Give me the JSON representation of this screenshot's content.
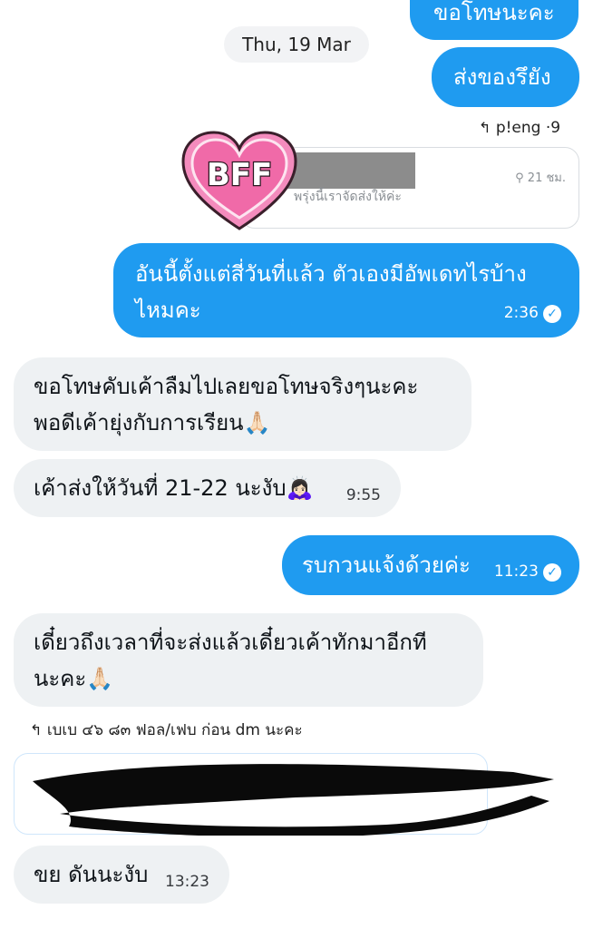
{
  "messages": {
    "m0": {
      "text": "ขอโทษนะคะ"
    },
    "date_separator": "Thu, 19 Mar",
    "m1": {
      "text": "ส่งของรึยัง"
    },
    "reply1": {
      "label": "p!eng ·9"
    },
    "card1": {
      "sticker_text": "BFF",
      "subtitle": "พรุ่งนี้เราจัดส่งให้ค่ะ",
      "meta": "21 ชม."
    },
    "m2": {
      "text_line1": "อันนี้ตั้งแต่สี่วันที่แล้ว ตัวเองมีอัพเดทไรบ้าง",
      "text_line2": "ไหมคะ",
      "time": "2:36"
    },
    "m3": {
      "text_line1": "ขอโทษคับเค้าลืมไปเลยขอโทษจริงๆนะคะ",
      "text_line2": "พอดีเค้ายุ่งกับการเรียน🙏🏻"
    },
    "m4": {
      "text": "เค้าส่งให้วันที่ 21-22 นะงับ🙇🏻‍♀️",
      "time": "9:55"
    },
    "m5": {
      "text": "รบกวนแจ้งด้วยค่ะ",
      "time": "11:23"
    },
    "m6": {
      "text_line1": "เดี๋ยวถึงเวลาที่จะส่งแล้วเดี๋ยวเค้าทักมาอีกที",
      "text_line2": "นะคะ🙏🏻"
    },
    "reply2": {
      "label": "เบเบ ๔๖ ๘๓ ฟอล/เฟบ ก่อน dm นะคะ"
    },
    "m7": {
      "text": "ขย ดันนะงับ",
      "time": "13:23"
    }
  },
  "colors": {
    "outgoing": "#1f9bf0",
    "incoming": "#eef1f3",
    "heart": "#f06aa8"
  },
  "icons": {
    "reply": "reply-arrow-icon",
    "read": "check-circle-icon",
    "pin": "pin-icon"
  }
}
